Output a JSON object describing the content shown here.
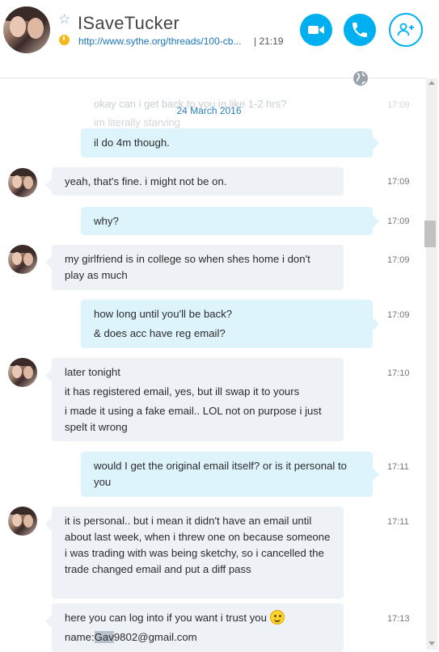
{
  "header": {
    "contact_name": "ISaveTucker",
    "mood_link": "http://www.sythe.org/threads/100-cb...",
    "local_time": "| 21:19"
  },
  "chat": {
    "date_separator": "24 March 2016",
    "faded_top": {
      "line1": "okay can i get back to you in like 1-2 hrs?",
      "line2": "im literally starving",
      "timestamp": "17:09"
    },
    "messages": [
      {
        "dir": "out",
        "lines": [
          "il do 4m though."
        ],
        "time": ""
      },
      {
        "dir": "in",
        "lines": [
          "yeah, that's fine.  i might not be on."
        ],
        "time": "17:09"
      },
      {
        "dir": "out",
        "lines": [
          "why?"
        ],
        "time": "17:09"
      },
      {
        "dir": "in",
        "lines": [
          "my girlfriend is in college so when shes home i don't play as much"
        ],
        "time": "17:09"
      },
      {
        "dir": "out",
        "lines": [
          "how long until you'll be back?",
          "& does acc have reg email?"
        ],
        "time": "17:09"
      },
      {
        "dir": "in",
        "lines": [
          "later tonight",
          "it has registered email, yes, but ill swap it to yours",
          "i made it using a fake email.. LOL not on purpose i just spelt it wrong"
        ],
        "time": "17:10"
      },
      {
        "dir": "out",
        "lines": [
          "would I get the original email itself? or is it personal to you"
        ],
        "time": "17:11"
      },
      {
        "dir": "in",
        "lines": [
          "it is personal.. but i mean it didn't have an email until about last week, when i threw one on because someone i was trading with was being sketchy, so i cancelled the trade changed email and put a diff pass"
        ],
        "time": "17:11"
      },
      {
        "dir": "in",
        "lines": [
          "here you can log into if you want i trust you"
        ],
        "time": "17:13",
        "name_prefix": "name:",
        "name_hl": "Gav",
        "name_rest": "9802@gmail.com"
      }
    ]
  },
  "colors": {
    "accent": "#00aff0",
    "incoming_bubble": "#eef1f5",
    "outgoing_bubble": "#ddf4fd",
    "link": "#1a73b8"
  },
  "icons": [
    "favorite-star-icon",
    "clock-icon",
    "video-call-icon",
    "audio-call-icon",
    "add-contact-icon",
    "globe-icon",
    "smiley-emoticon-icon"
  ]
}
